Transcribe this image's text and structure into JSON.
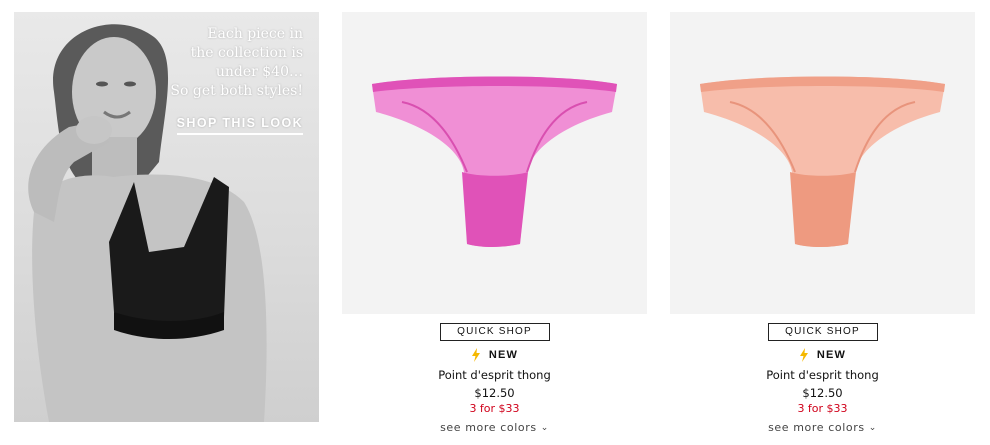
{
  "promo": {
    "lines": [
      "Each piece in",
      "the collection is",
      "under $40…",
      "So get both styles!"
    ],
    "cta": "SHOP THIS LOOK"
  },
  "products": [
    {
      "quick_shop": "QUICK SHOP",
      "badge": "NEW",
      "badge_icon": "lightning-bolt-icon",
      "name": "Point d'esprit thong",
      "price": "$12.50",
      "promo_price": "3 for $33",
      "see_more": "see more colors",
      "color": "#e052b8"
    },
    {
      "quick_shop": "QUICK SHOP",
      "badge": "NEW",
      "badge_icon": "lightning-bolt-icon",
      "name": "Point d'esprit thong",
      "price": "$12.50",
      "promo_price": "3 for $33",
      "see_more": "see more colors",
      "color": "#f0a088"
    }
  ],
  "colors": {
    "accent_red": "#d0021b",
    "bolt_yellow": "#f5b800"
  }
}
